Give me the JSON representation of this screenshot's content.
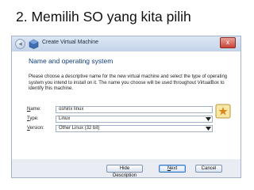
{
  "slide": {
    "title": "2. Memilih SO yang kita pilih"
  },
  "window": {
    "title": "Create Virtual Machine",
    "close_label": "x",
    "back_label": "◂"
  },
  "page": {
    "heading": "Name and operating system",
    "description": "Please choose a descriptive name for the new virtual machine and select the type of operating system you intend to install on it. The name you choose will be used throughout VirtualBox to identify this machine."
  },
  "form": {
    "name": {
      "label_prefix": "N",
      "label_rest": "ame:",
      "value": "oshirix linux"
    },
    "type": {
      "label_prefix": "T",
      "label_rest": "ype:",
      "value": "Linux"
    },
    "version": {
      "label_prefix": "V",
      "label_rest": "ersion:",
      "value": "Other Linux (32 bit)"
    }
  },
  "buttons": {
    "hide_description": "Hide Description",
    "next_prefix": "N",
    "next_rest": "ext",
    "cancel": "Cancel"
  },
  "icons": {
    "back": "back-arrow-icon",
    "app": "virtualbox-icon",
    "os": "other-os-icon",
    "close": "close-icon"
  }
}
